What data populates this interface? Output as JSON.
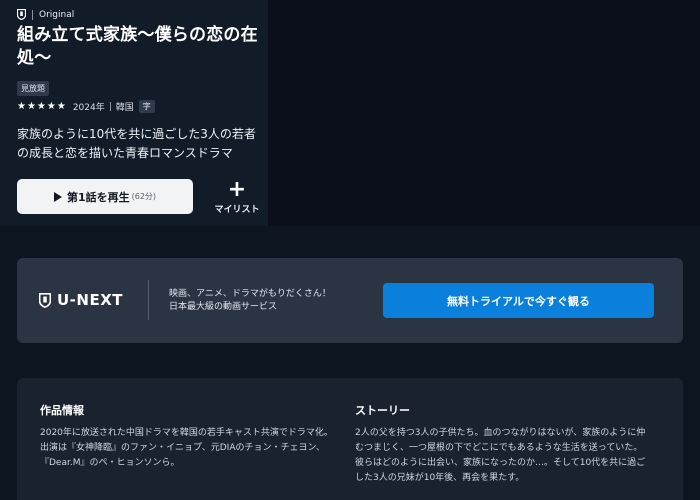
{
  "hero": {
    "badge": "Original",
    "title": "組み立て式家族〜僕らの恋の在処〜",
    "tag": "見放題",
    "stars": "★★★★★",
    "year": "2024年",
    "country": "韓国",
    "subtitle_badge": "字",
    "description": "家族のように10代を共に過ごした3人の若者の成長と恋を描いた青春ロマンスドラマ",
    "play_label": "第1話を再生",
    "play_duration": "(62分)",
    "mylist_label": "マイリスト"
  },
  "promo": {
    "logo": "U-NEXT",
    "line1": "映画、アニメ、ドラマがもりだくさん！",
    "line2": "日本最大級の動画サービス",
    "trial_label": "無料トライアルで今すぐ観る"
  },
  "info": {
    "work_title": "作品情報",
    "work_body": "2020年に放送された中国ドラマを韓国の若手キャスト共演でドラマ化。出演は『女神降臨』のファン・イニョプ、元DIAのチョン・チェヨン、『Dear.M』のペ・ヒョンソンら。",
    "story_title": "ストーリー",
    "story_body": "2人の父を持つ3人の子供たち。血のつながりはないが、家族のように仲むつまじく、一つ屋根の下でどこにでもあるような生活を送っていた。彼らはどのように出会い、家族になったのか…。そして10代を共に過ごした3人の兄妹が10年後、再会を果たす。"
  },
  "icons": {
    "shield": "shield-icon",
    "play": "play-icon",
    "plus": "plus-icon"
  },
  "colors": {
    "background": "#0d1520",
    "accent": "#0a7fdc",
    "promo_bg": "#2b3442"
  }
}
